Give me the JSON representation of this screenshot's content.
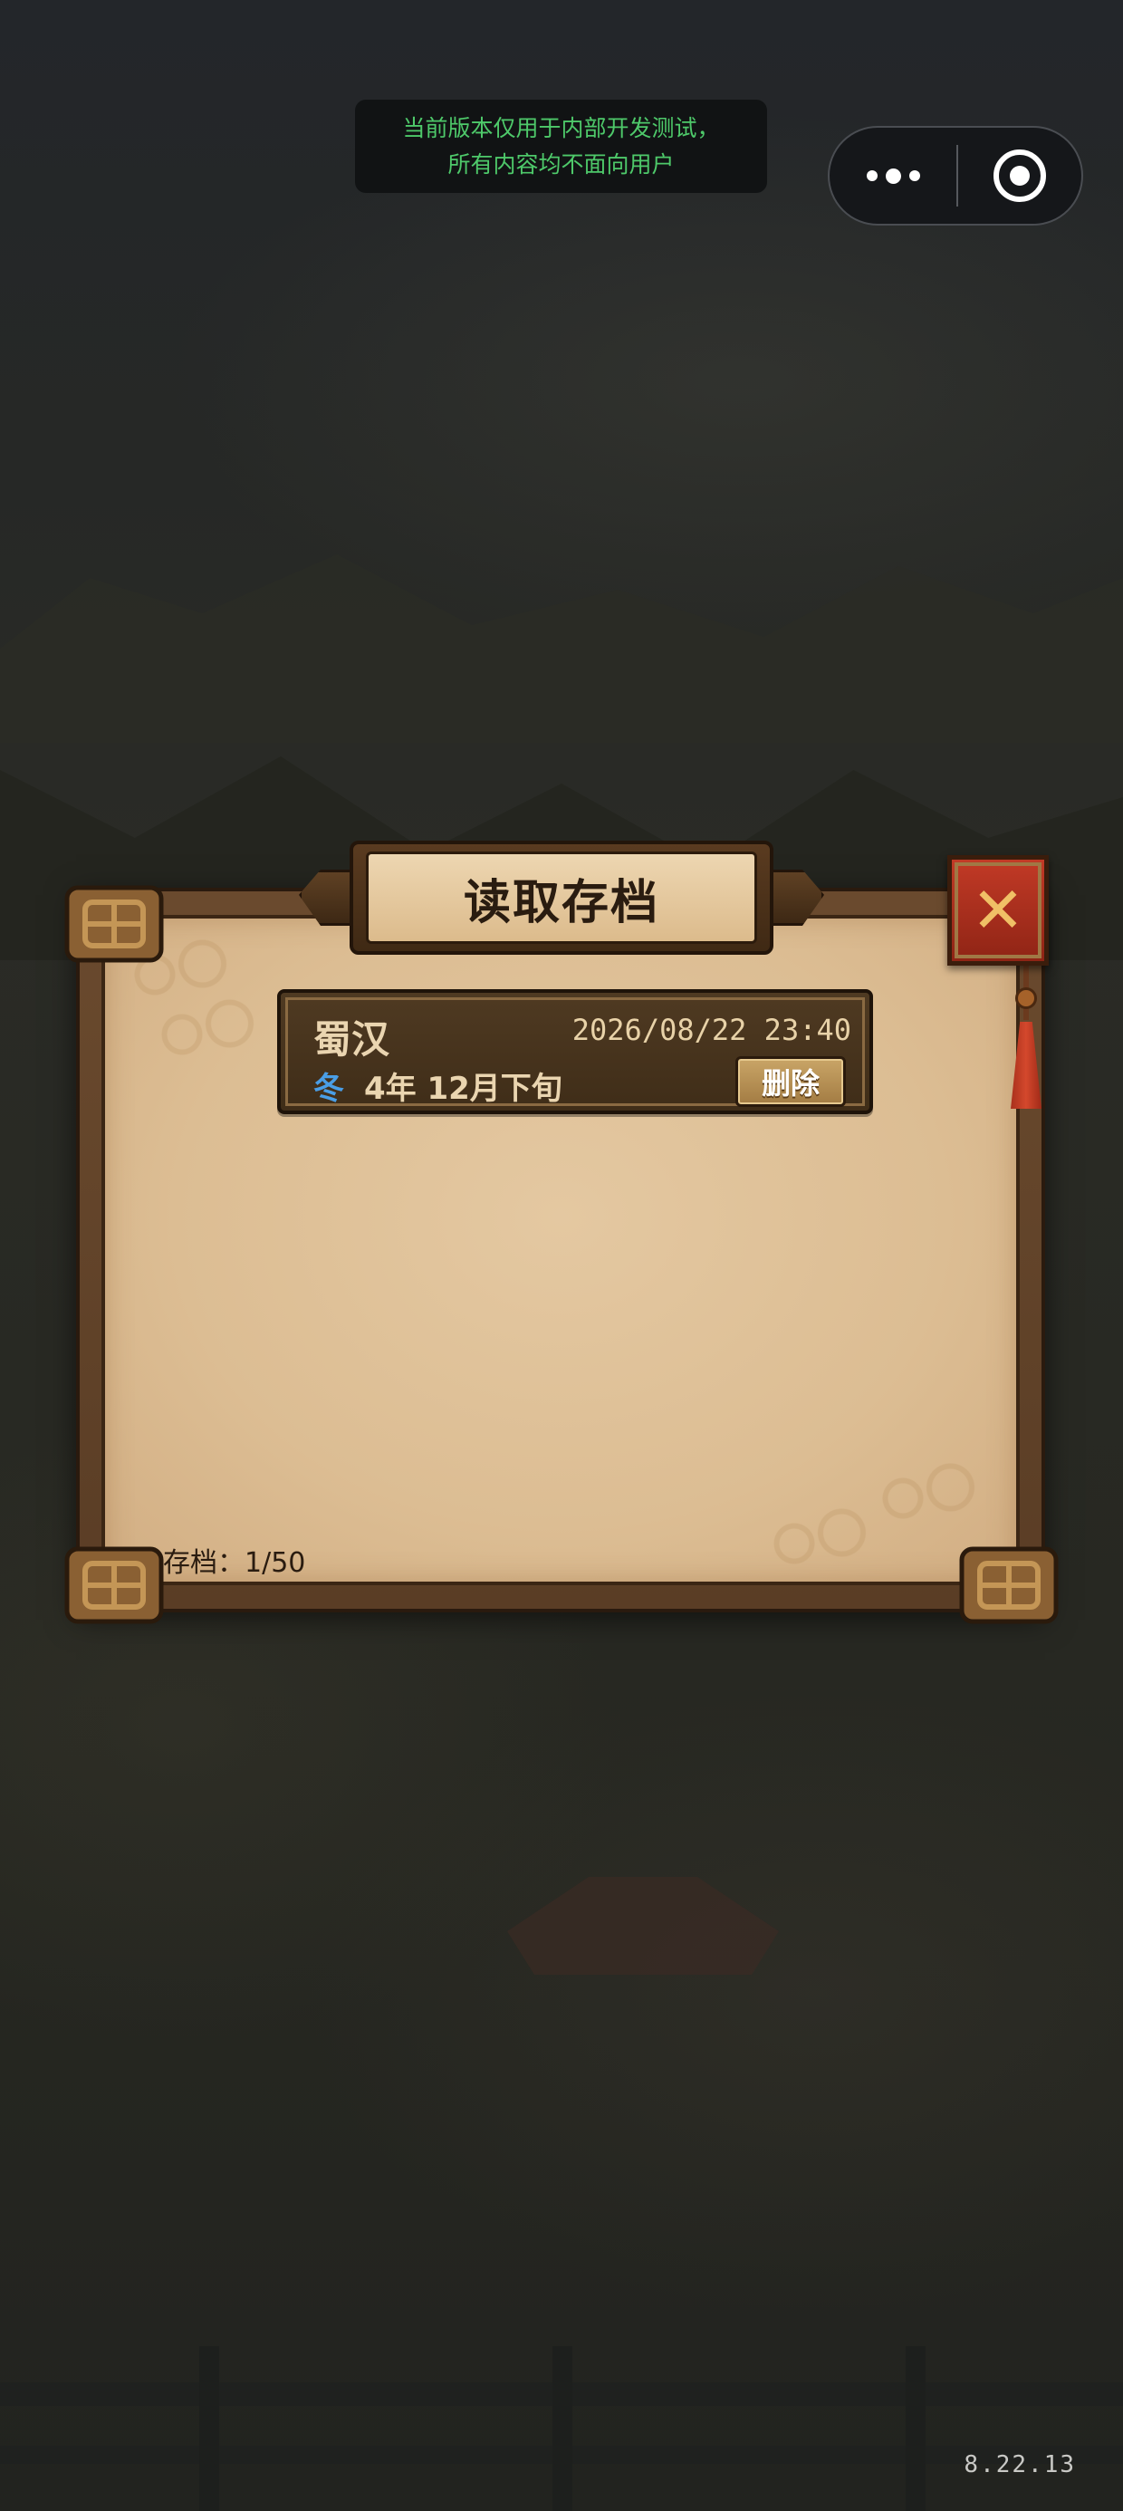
{
  "system": {
    "test_banner_line1": "当前版本仅用于内部开发测试，",
    "test_banner_line2": "所有内容均不面向用户",
    "capsule_menu_icon": "more-dots-icon",
    "capsule_close_icon": "target-circle-icon"
  },
  "dialog": {
    "title": "读取存档",
    "close_icon": "close-x-icon",
    "save_count_label": "存档：1/50"
  },
  "saves": [
    {
      "name": "蜀汉",
      "datetime": "2026/08/22 23:40",
      "season": "冬",
      "game_time": "4年 12月下旬",
      "delete_label": "删除"
    }
  ],
  "version": "8.22.13",
  "colors": {
    "banner_text": "#4ec96a",
    "season_winter": "#4a9ee6",
    "close_button": "#c23a26",
    "parchment": "#e4c8a1"
  }
}
